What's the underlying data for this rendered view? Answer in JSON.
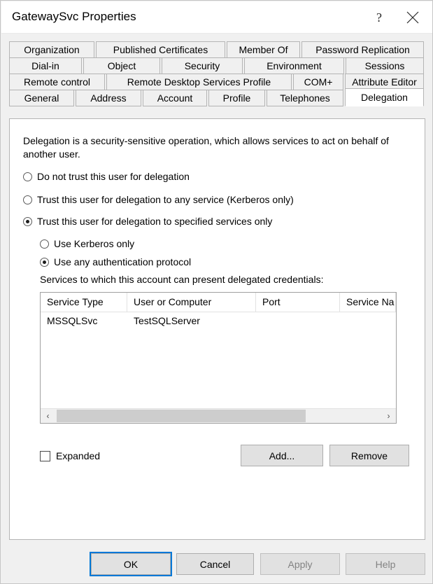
{
  "window": {
    "title": "GatewaySvc Properties",
    "help_button": "?",
    "close_button": "✕"
  },
  "tabs": {
    "rows": [
      [
        {
          "label": "Organization",
          "selected": false
        },
        {
          "label": "Published Certificates",
          "selected": false
        },
        {
          "label": "Member Of",
          "selected": false
        },
        {
          "label": "Password Replication",
          "selected": false
        }
      ],
      [
        {
          "label": "Dial-in",
          "selected": false
        },
        {
          "label": "Object",
          "selected": false
        },
        {
          "label": "Security",
          "selected": false
        },
        {
          "label": "Environment",
          "selected": false
        },
        {
          "label": "Sessions",
          "selected": false
        }
      ],
      [
        {
          "label": "Remote control",
          "selected": false
        },
        {
          "label": "Remote Desktop Services Profile",
          "selected": false
        },
        {
          "label": "COM+",
          "selected": false
        },
        {
          "label": "Attribute Editor",
          "selected": false
        }
      ],
      [
        {
          "label": "General",
          "selected": false
        },
        {
          "label": "Address",
          "selected": false
        },
        {
          "label": "Account",
          "selected": false
        },
        {
          "label": "Profile",
          "selected": false
        },
        {
          "label": "Telephones",
          "selected": false
        },
        {
          "label": "Delegation",
          "selected": true
        }
      ]
    ]
  },
  "delegation": {
    "description": "Delegation is a security-sensitive operation, which allows services to act on behalf of another user.",
    "options": [
      {
        "label": "Do not trust this user for delegation",
        "checked": false
      },
      {
        "label": "Trust this user for delegation to any service (Kerberos only)",
        "checked": false
      },
      {
        "label": "Trust this user for delegation to specified services only",
        "checked": true
      }
    ],
    "protocol_options": [
      {
        "label": "Use Kerberos only",
        "checked": false
      },
      {
        "label": "Use any authentication protocol",
        "checked": true
      }
    ],
    "list_label": "Services to which this account can present delegated credentials:",
    "list": {
      "columns": [
        "Service Type",
        "User or Computer",
        "Port",
        "Service Na"
      ],
      "rows": [
        [
          "MSSQLSvc",
          "TestSQLServer",
          "",
          ""
        ]
      ]
    },
    "scrollbar": {
      "left_arrow": "‹",
      "right_arrow": "›"
    },
    "expanded_checkbox": {
      "label": "Expanded",
      "checked": false
    },
    "add_button": "Add...",
    "remove_button": "Remove"
  },
  "footer": {
    "ok": "OK",
    "cancel": "Cancel",
    "apply": "Apply",
    "help": "Help"
  },
  "colors": {
    "accent": "#0078d7",
    "dialog_bg": "#f0f0f0",
    "panel_bg": "#ffffff"
  }
}
